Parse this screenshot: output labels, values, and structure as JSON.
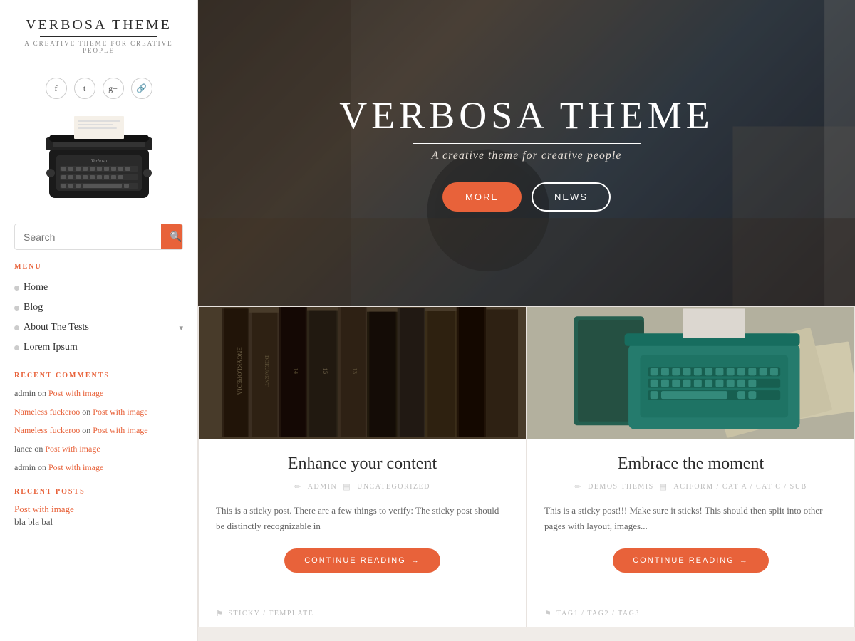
{
  "sidebar": {
    "logo": {
      "title": "VERBOSA THEME",
      "subtitle": "A CREATIVE THEME FOR CREATIVE PEOPLE"
    },
    "social": [
      {
        "icon": "f",
        "name": "facebook"
      },
      {
        "icon": "t",
        "name": "twitter"
      },
      {
        "icon": "g+",
        "name": "googleplus"
      },
      {
        "icon": "🔗",
        "name": "link"
      }
    ],
    "search": {
      "placeholder": "Search"
    },
    "menu_label": "MENU",
    "menu_items": [
      {
        "label": "Home",
        "has_sub": false
      },
      {
        "label": "Blog",
        "has_sub": false
      },
      {
        "label": "About The Tests",
        "has_sub": true
      },
      {
        "label": "Lorem Ipsum",
        "has_sub": false
      }
    ],
    "recent_comments_label": "RECENT COMMENTS",
    "comments": [
      {
        "author": "admin",
        "link_text": "Post with image",
        "pre": "admin on "
      },
      {
        "author": "Nameless fuckeroo",
        "link_text": "Post with image",
        "pre": "Nameless fuckeroo on "
      },
      {
        "author": "Nameless fuckeroo",
        "link_text": "Post with image",
        "pre": "Nameless fuckeroo on "
      },
      {
        "author": "lance",
        "link_text": "Post with image",
        "pre": "lance on "
      },
      {
        "author": "admin",
        "link_text": "Post with image",
        "pre": "admin on "
      }
    ],
    "recent_posts_label": "RECENT POSTS",
    "recent_posts": [
      {
        "label": "Post with image"
      },
      {
        "label": "bla bla bal"
      }
    ]
  },
  "hero": {
    "title": "VERBOSA THEME",
    "subtitle": "A creative theme for creative people",
    "btn_more": "MORE",
    "btn_news": "NEWS"
  },
  "posts": [
    {
      "title": "Enhance your content",
      "author": "ADMIN",
      "category": "UNCATEGORIZED",
      "excerpt": "This is a sticky post. There are a few things to verify: The sticky post should be distinctly recognizable in",
      "continue": "CONTINUE READING",
      "tags": "STICKY / TEMPLATE"
    },
    {
      "title": "Embrace the moment",
      "author": "DEMOS THEMIS",
      "category": "ACIFORM / CAT A / CAT C / SUB",
      "excerpt": "This is a sticky post!!! Make sure it sticks! This should then split into other pages with layout, images...",
      "continue": "CONTINUE READING",
      "tags": "TAG1 / TAG2 / TAG3"
    }
  ],
  "colors": {
    "accent": "#e8623a",
    "text_dark": "#2a2a2a",
    "text_muted": "#888",
    "link": "#e8623a"
  }
}
